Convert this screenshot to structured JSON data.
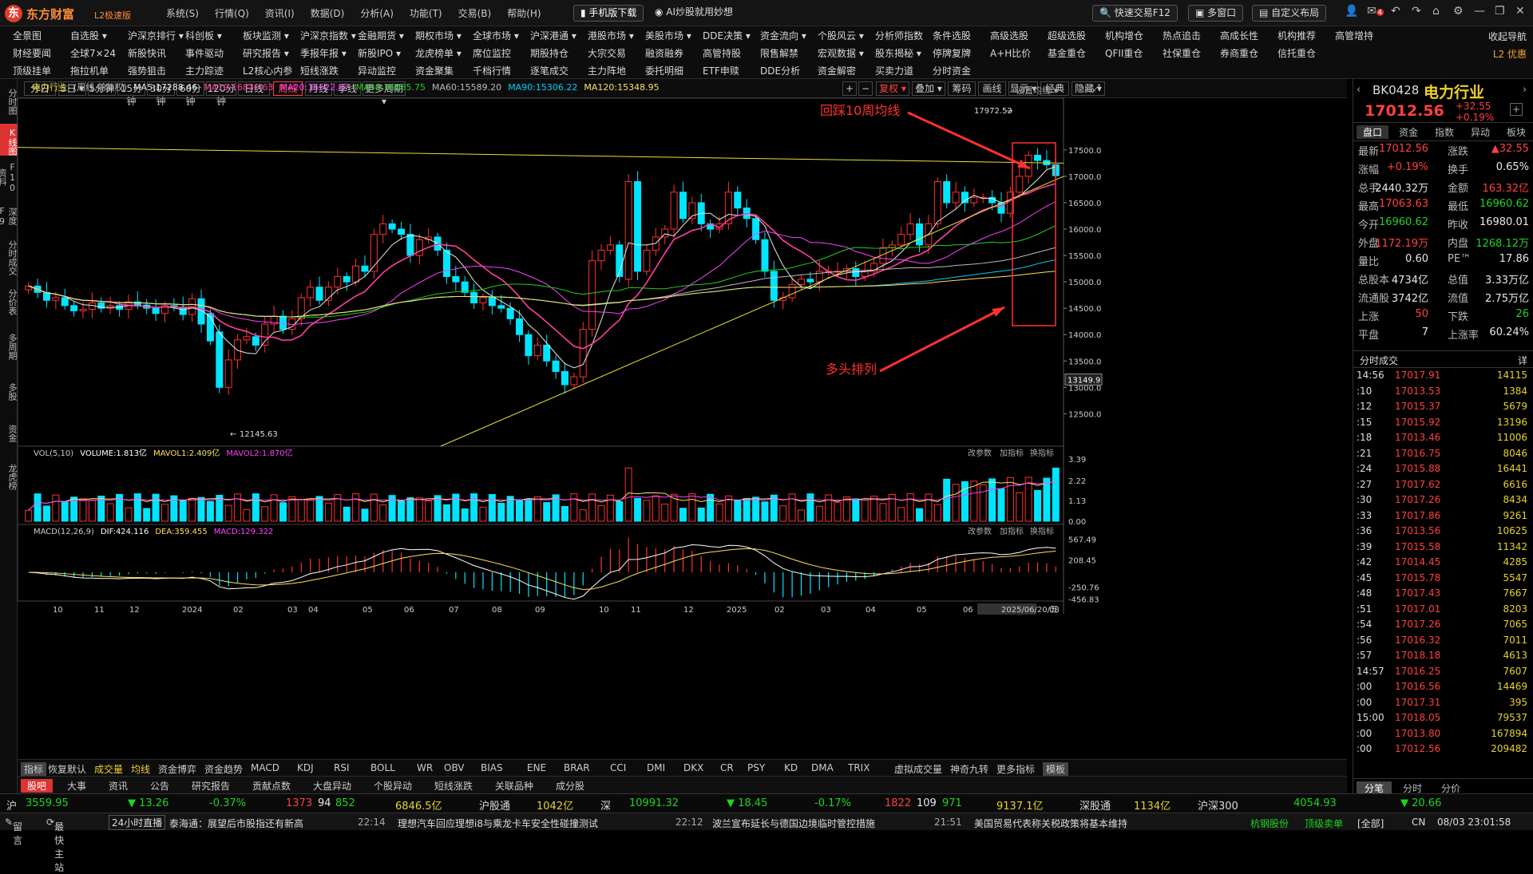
{
  "app": {
    "name": "东方财富",
    "edition": "L2极速版",
    "logo": "东",
    "menus": [
      "系统(S)",
      "行情(Q)",
      "资讯(I)",
      "数据(D)",
      "分析(A)",
      "功能(T)",
      "交易(B)",
      "帮助(H)"
    ],
    "mobile_btn": "手机版下载",
    "ai_btn": "AI炒股就用妙想",
    "quick_trade": "快速交易F12",
    "multi_window": "多窗口",
    "custom_layout": "自定义布局",
    "badge": "4"
  },
  "nav": {
    "row1": [
      "全景图",
      "自选股 ▾",
      "沪深京排行 ▾",
      "科创板 ▾",
      "板块监测 ▾",
      "沪深京指数 ▾",
      "金融期货 ▾",
      "期权市场 ▾",
      "全球市场 ▾",
      "沪深港通 ▾",
      "港股市场 ▾",
      "美股市场 ▾",
      "DDE决策 ▾",
      "资金流向 ▾",
      "个股风云 ▾",
      "分析师指数",
      "条件选股",
      "高级选股",
      "超级选股",
      "机构增仓",
      "热点追击",
      "高成长性",
      "机构推荐",
      "高管增持"
    ],
    "row2": [
      "财经要闻",
      "全球7×24",
      "新股快讯",
      "事件驱动",
      "研究报告 ▾",
      "季报年报 ▾",
      "新股IPO ▾",
      "龙虎榜单 ▾",
      "席位监控",
      "期股持仓",
      "大宗交易",
      "融资融券",
      "高管持股",
      "限售解禁",
      "宏观数据 ▾",
      "股东揭秘 ▾",
      "停牌复牌",
      "A+H比价",
      "基金重仓",
      "QFII重仓",
      "社保重仓",
      "券商重仓",
      "信托重仓"
    ],
    "row3": [
      "顶级挂单",
      "拖拉机单",
      "强势狙击",
      "主力踪迹",
      "L2核心内参",
      "短线涨跌",
      "异动监控",
      "资金聚集",
      "千档行情",
      "逐笔成交",
      "主力阵地",
      "委托明细",
      "ETF申赎",
      "DDE分析",
      "资金解密",
      "买卖力道",
      "分时资金"
    ],
    "right1": "收起导航",
    "right2": "L2 优惠"
  },
  "left_tabs": [
    "分时图",
    "K线图",
    "F10资料",
    "深度F9",
    "分时成交",
    "分价表",
    "多周期",
    "多股",
    "资金",
    "龙虎榜"
  ],
  "periods": [
    "分日",
    "5日 ▾",
    "5分钟",
    "15分钟",
    "30分钟",
    "60分钟",
    "120分钟",
    "日线",
    "周线",
    "月线",
    "季线",
    "更多周期 ▾"
  ],
  "active_period": "周线",
  "tools": [
    "复权 ▾",
    "叠加 ▾",
    "筹码",
    "画线",
    "显示 ▾",
    "经典",
    "隐藏 ▾"
  ],
  "ma_bar": {
    "name": "电力行业",
    "mode": "(周线,前复权)",
    "ma5": "MA5:17288.46",
    "ma10": "MA10:16830.63",
    "ma20": "MA20:16522.87",
    "ma30": "MA30:16085.75",
    "ma60": "MA60:15589.20",
    "ma90": "MA90:15306.22",
    "ma120": "MA120:15348.95",
    "set_ma": "设置均线 ▾"
  },
  "annotations": {
    "pullback": "回踩10周均线",
    "bull": "多头排列",
    "high_label": "17972.52",
    "low_label": "12145.63",
    "crosshair_price": "13149.9"
  },
  "vol_bar": {
    "name": "VOL(5,10)",
    "volume": "VOLUME:1.813亿",
    "mavol1": "MAVOL1:2.409亿",
    "mavol2": "MAVOL2:1.870亿",
    "change_param": "改参数",
    "add_ind": "加指标",
    "switch_ind": "换指标"
  },
  "macd_bar": {
    "name": "MACD(12,26,9)",
    "dif": "DIF:424.116",
    "dea": "DEA:359.455",
    "macd": "MACD:129.322"
  },
  "x_ticks": [
    "10",
    "11",
    "12",
    "2024",
    "02",
    "03",
    "04",
    "05",
    "06",
    "07",
    "08",
    "09",
    "10",
    "11",
    "12",
    "2025",
    "02",
    "03",
    "04",
    "05",
    "06",
    "2025/06/20/五",
    "08"
  ],
  "y_price_ticks": [
    "17500.0",
    "17000.0",
    "16500.0",
    "16000.0",
    "15500.0",
    "15000.0",
    "14500.0",
    "14000.0",
    "13500.0",
    "13000.0",
    "12500.0"
  ],
  "y_vol_ticks": [
    "3.39",
    "2.22",
    "1.13",
    "0.00"
  ],
  "y_macd_ticks": [
    "567.49",
    "208.45",
    "-250.76",
    "-456.83"
  ],
  "indicators": [
    "指标",
    "恢复默认",
    "成交量",
    "均线",
    "资金博弈",
    "资金趋势",
    "MACD",
    "KDJ",
    "RSI",
    "BOLL",
    "WR",
    "OBV",
    "BIAS",
    "ENE",
    "BRAR",
    "CCI",
    "DMI",
    "DKX",
    "CR",
    "PSY",
    "KD",
    "DMA",
    "TRIX",
    "虚拟成交量",
    "神奇九转",
    "更多指标",
    "模板"
  ],
  "info_tabs": [
    "股吧",
    "大事",
    "资讯",
    "公告",
    "研究报告",
    "贡献点数",
    "大盘异动",
    "个股异动",
    "短线涨跌",
    "关联品种",
    "成分股"
  ],
  "quote": {
    "code": "BK0428",
    "name": "电力行业",
    "price": "17012.56",
    "chg": "+32.55",
    "pct": "+0.19%",
    "tabs": [
      "盘口",
      "资金",
      "指数",
      "异动",
      "板块"
    ],
    "rows": [
      [
        "最新",
        "17012.56",
        "涨跌",
        "▲32.55"
      ],
      [
        "涨幅",
        "+0.19%",
        "换手",
        "0.65%"
      ],
      [
        "总手",
        "2440.32万",
        "金额",
        "163.32亿"
      ],
      [
        "最高",
        "17063.63",
        "最低",
        "16960.62"
      ],
      [
        "今开",
        "16960.62",
        "昨收",
        "16980.01"
      ],
      [
        "外盘",
        "1172.19万",
        "内盘",
        "1268.12万"
      ],
      [
        "量比",
        "0.60",
        "PE™",
        "17.86"
      ],
      [
        "总股本",
        "4734亿",
        "总值",
        "3.33万亿"
      ],
      [
        "流通股",
        "3742亿",
        "流值",
        "2.75万亿"
      ],
      [
        "上涨",
        "50",
        "下跌",
        "26"
      ],
      [
        "平盘",
        "7",
        "上涨率",
        "60.24%"
      ]
    ],
    "ticks_title": "分时成交",
    "ticks_btn": "详",
    "ticks": [
      [
        "14:56",
        "17017.91",
        "14115"
      ],
      [
        ":10",
        "17013.53",
        "1384"
      ],
      [
        ":12",
        "17015.37",
        "5679"
      ],
      [
        ":15",
        "17015.92",
        "13196"
      ],
      [
        ":18",
        "17013.46",
        "11006"
      ],
      [
        ":21",
        "17016.75",
        "8046"
      ],
      [
        ":24",
        "17015.88",
        "16441"
      ],
      [
        ":27",
        "17017.62",
        "6616"
      ],
      [
        ":30",
        "17017.26",
        "8434"
      ],
      [
        ":33",
        "17017.86",
        "9261"
      ],
      [
        ":36",
        "17013.56",
        "10625"
      ],
      [
        ":39",
        "17015.58",
        "11342"
      ],
      [
        ":42",
        "17014.45",
        "4285"
      ],
      [
        ":45",
        "17015.78",
        "5547"
      ],
      [
        ":48",
        "17017.43",
        "7667"
      ],
      [
        ":51",
        "17017.01",
        "8203"
      ],
      [
        ":54",
        "17017.26",
        "7065"
      ],
      [
        ":56",
        "17016.32",
        "7011"
      ],
      [
        ":57",
        "17018.18",
        "4613"
      ],
      [
        "14:57",
        "17016.25",
        "7607"
      ],
      [
        ":00",
        "17016.56",
        "14469"
      ],
      [
        ":00",
        "17017.31",
        "395"
      ],
      [
        "15:00",
        "17018.05",
        "79537"
      ],
      [
        ":00",
        "17013.80",
        "167894"
      ],
      [
        ":00",
        "17012.56",
        "209482"
      ]
    ],
    "bottom_tabs": [
      "分笔",
      "分时",
      "分价"
    ]
  },
  "status": {
    "sh": "沪",
    "sh_val": "3559.95",
    "sh_chg": "▼ 13.26",
    "sh_pct": "-0.37%",
    "sh_amt": "1373",
    "sh_up": "94",
    "sh_dn": "852",
    "sh_vol": "6846.5亿",
    "hgt": "沪股通",
    "hgt_val": "1042亿",
    "sz": "深",
    "sz_val": "10991.32",
    "sz_chg": "▼ 18.45",
    "sz_pct": "-0.17%",
    "sz_up": "1822",
    "sz_flat": "109",
    "sz_dn": "971",
    "sz_vol": "9137.1亿",
    "sgt": "深股通",
    "sgt_val": "1134亿",
    "hs300": "沪深300",
    "hs300_val": "4054.93",
    "hs300_chg": "▼ 20.66"
  },
  "ticker": {
    "items": [
      "留言",
      "最快主站",
      "24小时直播",
      "泰海通：展望后市股指还有新高",
      "22:14",
      "理想汽车回应理想i8与乘龙卡车安全性碰撞测试",
      "22:12",
      "波兰宣布延长与德国边境临时管控措施",
      "21:51",
      "美国贸易代表称关税政策将基本维持",
      "杭钢股份",
      "顶级卖单",
      "[全部]"
    ],
    "time": "08/03 23:01:58",
    "lang": "CN"
  },
  "chart_data": {
    "type": "candlestick",
    "title": "电力行业",
    "period": "周线",
    "ylim": [
      11900,
      18300
    ],
    "high": 17972.52,
    "low": 12145.63,
    "note": "Weekly K-line approx. Oct 2023 – Aug 2025 with MA5/10/20/30/60/90/120, VOL and MACD panes"
  }
}
